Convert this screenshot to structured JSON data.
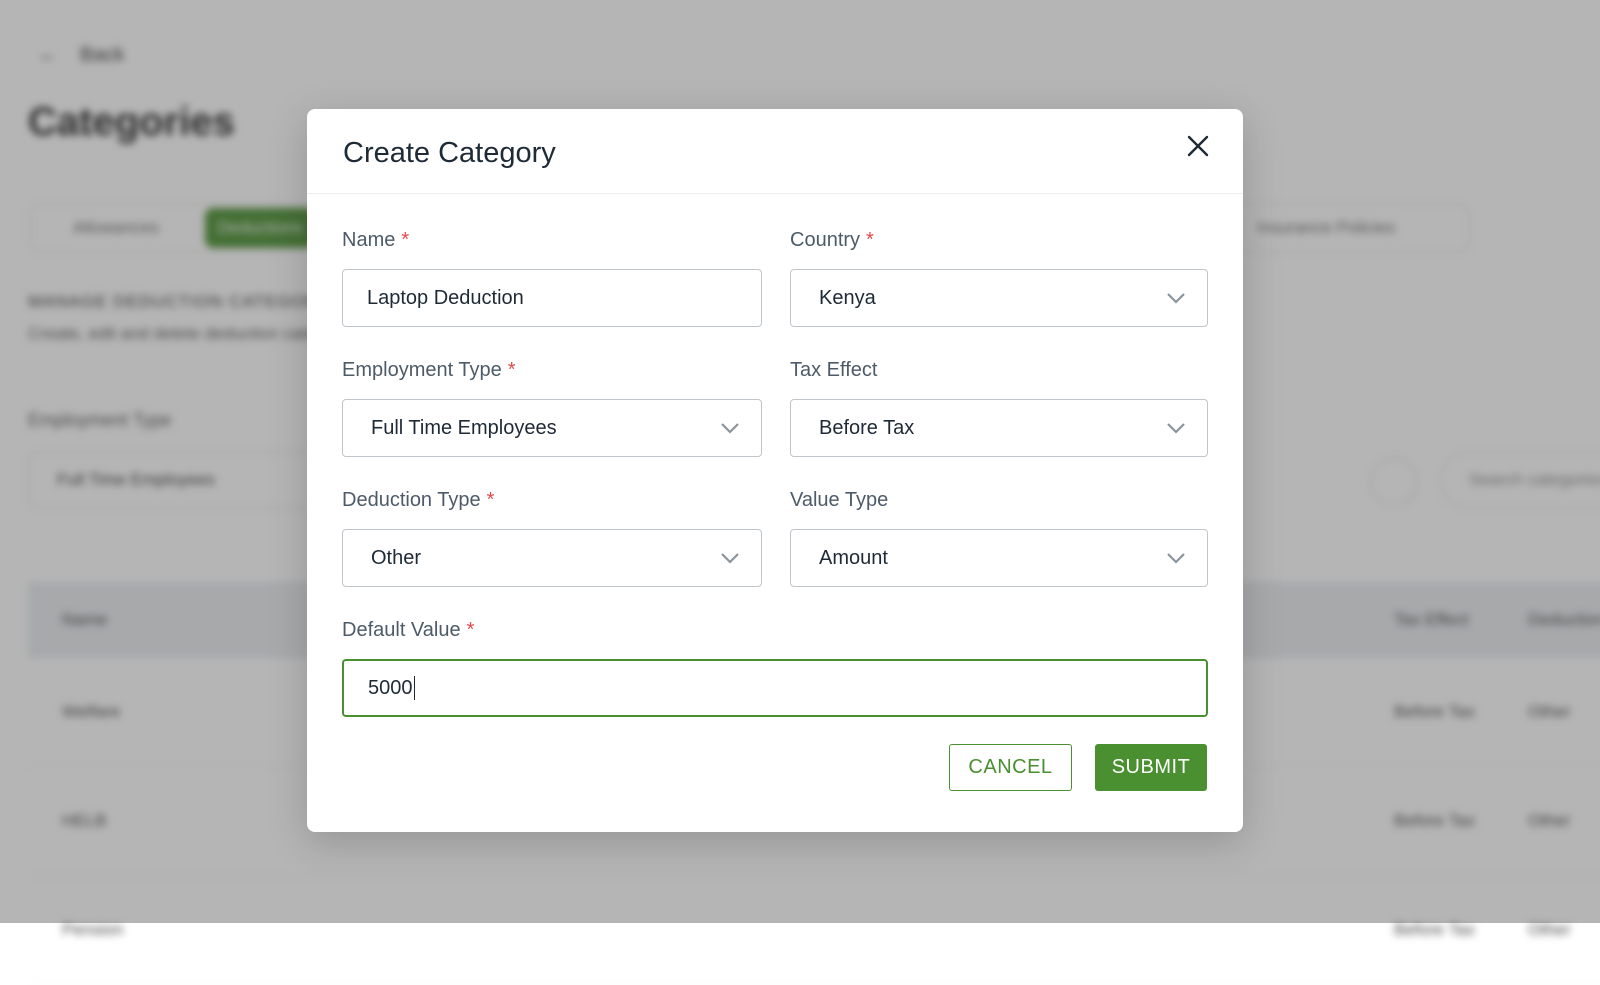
{
  "background": {
    "back_label": "Back",
    "page_title": "Categories",
    "tabs": [
      "Allowances",
      "Deductions",
      "Insurance Policies"
    ],
    "section_title": "MANAGE DEDUCTION CATEGORIES",
    "section_subtitle": "Create, edit and delete deduction categories",
    "filter_label": "Employment Type",
    "filter_value": "Full Time Employees",
    "search_placeholder": "Search categories",
    "table_headers": [
      "Name",
      "Tax Effect",
      "Deduction Type"
    ],
    "rows": [
      {
        "name": "Welfare",
        "tax_effect": "Before Tax",
        "type": "Other"
      },
      {
        "name": "HELB",
        "tax_effect": "Before Tax",
        "type": "Other"
      },
      {
        "name": "Pension",
        "tax_effect": "Before Tax",
        "type": "Other"
      }
    ]
  },
  "modal": {
    "title": "Create Category",
    "close_icon": "close-icon",
    "fields": {
      "name": {
        "label": "Name",
        "required": "*",
        "value": "Laptop Deduction"
      },
      "country": {
        "label": "Country",
        "required": "*",
        "value": "Kenya"
      },
      "employment_type": {
        "label": "Employment Type",
        "required": "*",
        "value": "Full Time Employees"
      },
      "tax_effect": {
        "label": "Tax Effect",
        "value": "Before Tax"
      },
      "deduction_type": {
        "label": "Deduction Type",
        "required": "*",
        "value": "Other"
      },
      "value_type": {
        "label": "Value Type",
        "value": "Amount"
      },
      "default_value": {
        "label": "Default Value",
        "required": "*",
        "value": "5000"
      }
    },
    "cancel_label": "CANCEL",
    "submit_label": "SUBMIT"
  },
  "colors": {
    "accent": "#4a8f30",
    "required": "#e5484d",
    "label": "#4d5b68",
    "text": "#1e2a36"
  }
}
